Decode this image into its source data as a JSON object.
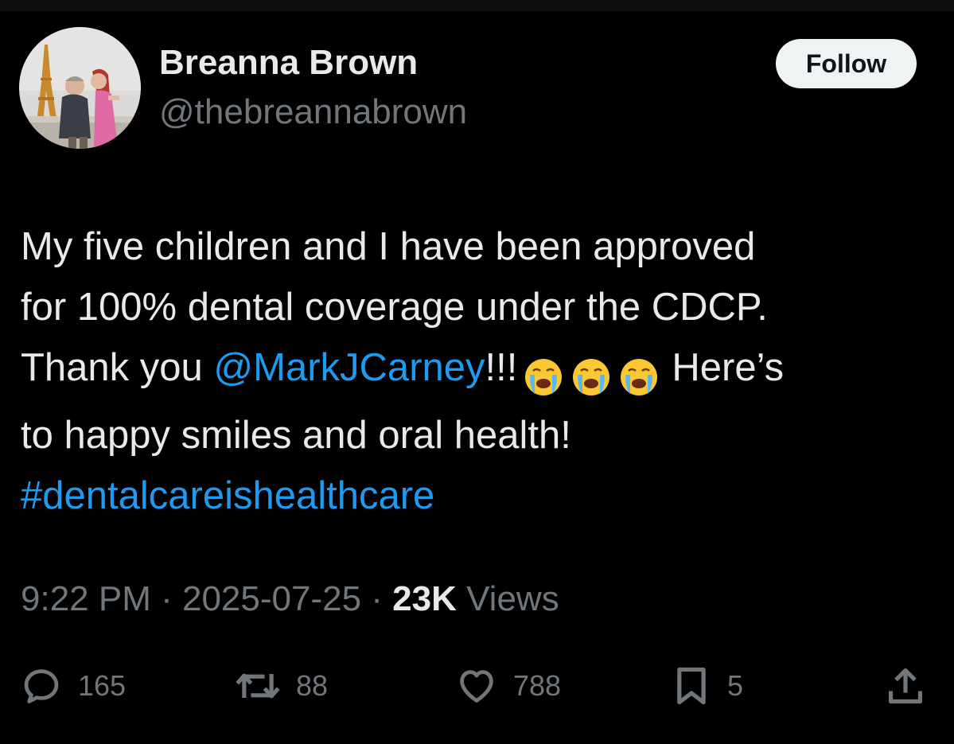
{
  "author": {
    "display_name": "Breanna Brown",
    "handle": "@thebreannabrown"
  },
  "follow_button": {
    "label": "Follow"
  },
  "tweet": {
    "line1": "My five children and I have been approved",
    "line2": "for 100% dental coverage under the CDCP.",
    "line3_prefix": "Thank you ",
    "mention": "@MarkJCarney",
    "line3_exclaim": "!!!",
    "emojis": [
      "loudly-crying-face",
      "loudly-crying-face",
      "loudly-crying-face"
    ],
    "line3_suffix": "Here’s",
    "line4": "to happy smiles and oral health!",
    "hashtag": "#dentalcareishealthcare"
  },
  "meta": {
    "time": "9:22 PM",
    "separator1": " · ",
    "date": "2025-07-25",
    "separator2": " · ",
    "views_count": "23K",
    "views_label": " Views"
  },
  "actions": {
    "replies": "165",
    "reposts": "88",
    "likes": "788",
    "bookmarks": "5"
  },
  "colors": {
    "background": "#000000",
    "text_primary": "#e7e9ea",
    "text_secondary": "#71767b",
    "link": "#1d9bf0",
    "follow_bg": "#eff3f4"
  }
}
